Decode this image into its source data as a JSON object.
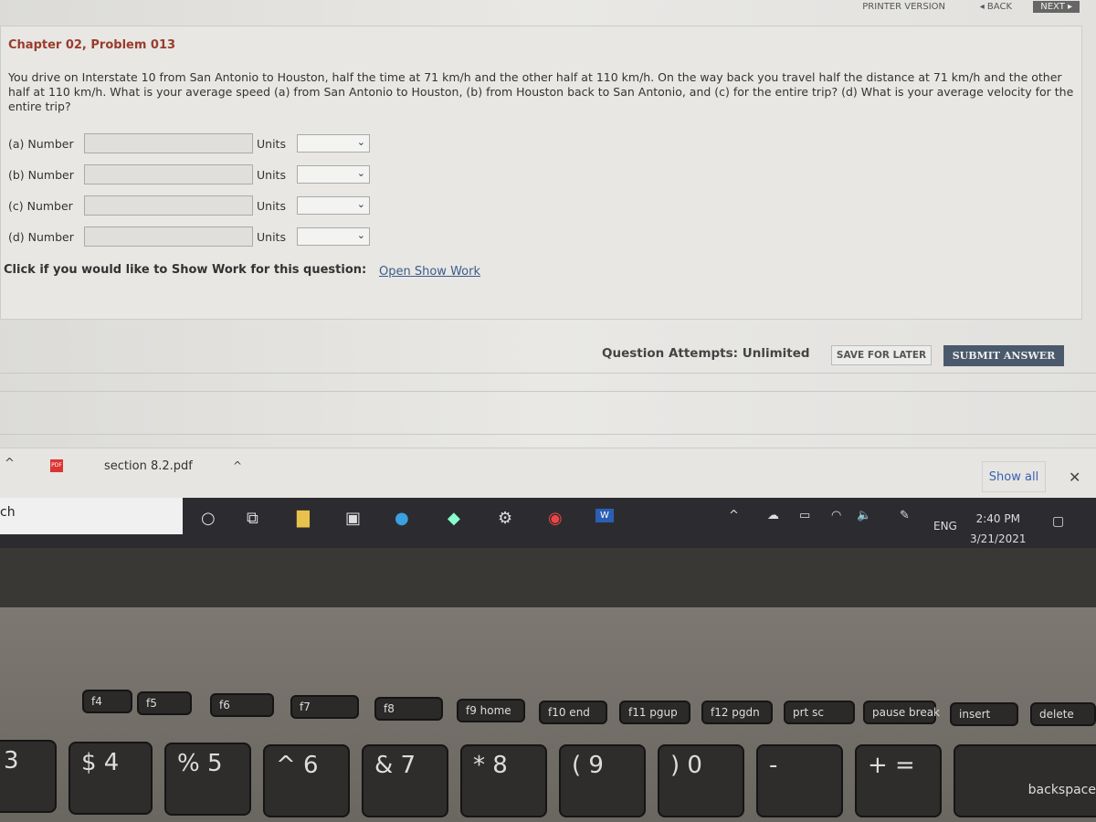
{
  "nav": {
    "printer": "PRINTER VERSION",
    "back": "◂ BACK",
    "next": "NEXT ▸"
  },
  "problem": {
    "title": "Chapter 02, Problem 013",
    "text": "You drive on Interstate 10 from San Antonio to Houston, half the time at 71 km/h and the other half at 110 km/h. On the way back you travel half the distance at 71 km/h and the other half at 110 km/h. What is your average speed (a) from San Antonio to Houston, (b) from Houston back to San Antonio, and (c) for the entire trip? (d) What is your average velocity for the entire trip?"
  },
  "answers": [
    {
      "label": "(a) Number",
      "value": "",
      "units_label": "Units",
      "units_value": ""
    },
    {
      "label": "(b) Number",
      "value": "",
      "units_label": "Units",
      "units_value": ""
    },
    {
      "label": "(c) Number",
      "value": "",
      "units_label": "Units",
      "units_value": ""
    },
    {
      "label": "(d) Number",
      "value": "",
      "units_label": "Units",
      "units_value": ""
    }
  ],
  "show_work": {
    "prompt": "Click if you would like to Show Work for this question:",
    "link": "Open Show Work"
  },
  "footer": {
    "attempts": "Question Attempts: Unlimited",
    "save": "SAVE FOR LATER",
    "submit": "SUBMIT ANSWER"
  },
  "downloads": {
    "file": "section 8.2.pdf",
    "file_icon": "PDF",
    "show_all": "Show all",
    "close": "✕"
  },
  "taskbar": {
    "search": "ch",
    "lang": "ENG",
    "time": "2:40 PM",
    "date": "3/21/2021",
    "word_icon": "W"
  },
  "keyboard": {
    "fn": [
      "f4",
      "f5",
      "f6",
      "f7",
      "f8",
      "f9 home",
      "f10 end",
      "f11 pgup",
      "f12 pgdn",
      "prt sc",
      "pause break",
      "insert",
      "delete"
    ],
    "num": [
      "3",
      "$ 4",
      "% 5",
      "^ 6",
      "& 7",
      "* 8",
      "( 9",
      ") 0",
      "-",
      "+ =",
      "backspace"
    ]
  }
}
